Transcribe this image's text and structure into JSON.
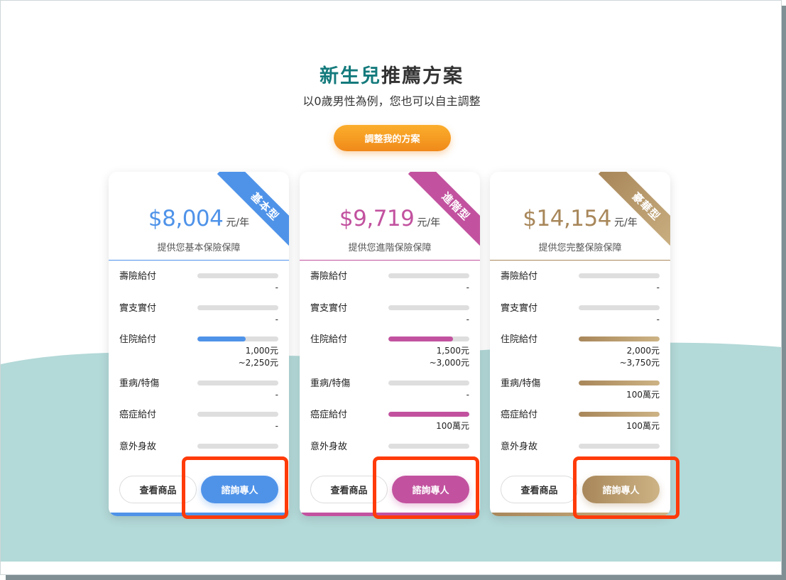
{
  "header": {
    "title_highlight": "新生兒",
    "title_rest": "推薦方案",
    "subtitle": "以0歲男性為例，您也可以自主調整",
    "adjust_button": "調整我的方案"
  },
  "colors": {
    "accent_title": "#147a7c",
    "adjust_button": "#f79a21",
    "wave": "#b3d9d8",
    "highlight_box": "#ff3b0a"
  },
  "plans": [
    {
      "ribbon": "基本型",
      "price": "$8,004",
      "unit": "元/年",
      "description": "提供您基本保險保障",
      "color": "#4f93e9",
      "color_end": "#4f93e9",
      "benefits": [
        {
          "label": "壽險給付",
          "level": 0,
          "value": "-"
        },
        {
          "label": "實支實付",
          "level": 0,
          "value": "-"
        },
        {
          "label": "住院給付",
          "level": 0.6,
          "value": "1,000元\n~2,250元"
        },
        {
          "label": "重病/特傷",
          "level": 0,
          "value": "-"
        },
        {
          "label": "癌症給付",
          "level": 0,
          "value": "-"
        },
        {
          "label": "意外身故",
          "level": 0,
          "value": ""
        }
      ],
      "view_button": "查看商品",
      "consult_button": "諮詢專人"
    },
    {
      "ribbon": "進階型",
      "price": "$9,719",
      "unit": "元/年",
      "description": "提供您進階保險保障",
      "color": "#c2529f",
      "color_end": "#c2529f",
      "benefits": [
        {
          "label": "壽險給付",
          "level": 0,
          "value": "-"
        },
        {
          "label": "實支實付",
          "level": 0,
          "value": "-"
        },
        {
          "label": "住院給付",
          "level": 0.8,
          "value": "1,500元\n~3,000元"
        },
        {
          "label": "重病/特傷",
          "level": 0,
          "value": "-"
        },
        {
          "label": "癌症給付",
          "level": 1.0,
          "value": "100萬元"
        },
        {
          "label": "意外身故",
          "level": 0,
          "value": ""
        }
      ],
      "view_button": "查看商品",
      "consult_button": "諮詢專人"
    },
    {
      "ribbon": "豪華型",
      "price": "$14,154",
      "unit": "元/年",
      "description": "提供您完整保險保障",
      "color": "#a8875a",
      "color_end": "#cdb385",
      "benefits": [
        {
          "label": "壽險給付",
          "level": 0,
          "value": "-"
        },
        {
          "label": "實支實付",
          "level": 0,
          "value": "-"
        },
        {
          "label": "住院給付",
          "level": 1.0,
          "value": "2,000元\n~3,750元"
        },
        {
          "label": "重病/特傷",
          "level": 1.0,
          "value": "100萬元"
        },
        {
          "label": "癌症給付",
          "level": 1.0,
          "value": "100萬元"
        },
        {
          "label": "意外身故",
          "level": 0,
          "value": ""
        }
      ],
      "view_button": "查看商品",
      "consult_button": "諮詢專人"
    }
  ]
}
